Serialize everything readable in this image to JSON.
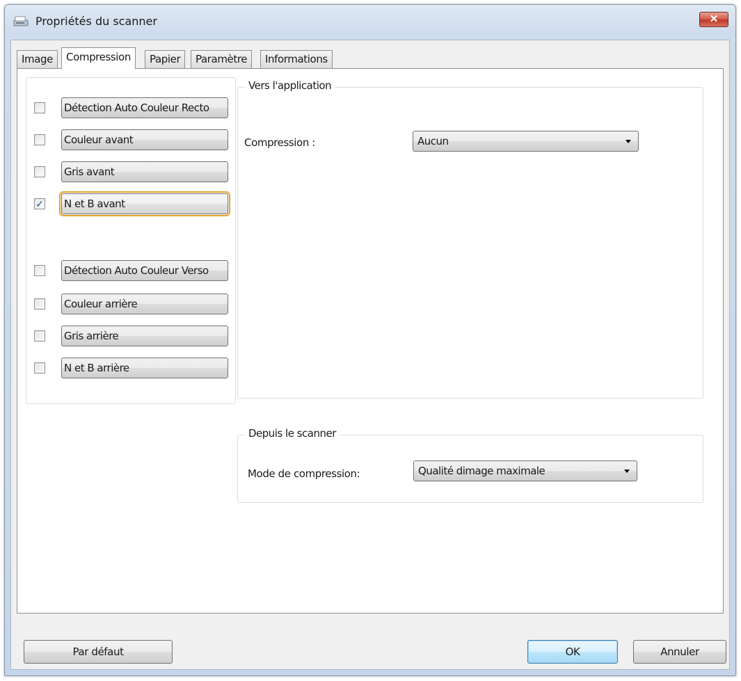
{
  "window": {
    "title": "Propriétés du scanner",
    "close_glyph": "✕"
  },
  "tabs": [
    {
      "label": "Image",
      "active": false
    },
    {
      "label": "Compression",
      "active": true
    },
    {
      "label": "Papier",
      "active": false
    },
    {
      "label": "Paramètre",
      "active": false
    },
    {
      "label": "Informations",
      "active": false
    }
  ],
  "image_types": [
    {
      "label": "Détection Auto Couleur Recto",
      "checked": false
    },
    {
      "label": "Couleur avant",
      "checked": false
    },
    {
      "label": "Gris avant",
      "checked": false
    },
    {
      "label": "N et B avant",
      "checked": true,
      "focused": true
    },
    {
      "label": "Détection Auto Couleur Verso",
      "checked": false
    },
    {
      "label": "Couleur arrière",
      "checked": false
    },
    {
      "label": "Gris arrière",
      "checked": false
    },
    {
      "label": "N et B arrière",
      "checked": false
    }
  ],
  "check_glyph": "✓",
  "to_application": {
    "group_label": "Vers l'application",
    "compression_label": "Compression :",
    "compression_value": "Aucun"
  },
  "from_scanner": {
    "group_label": "Depuis le scanner",
    "mode_label": "Mode de compression:",
    "mode_value": "Qualité dimage maximale"
  },
  "footer": {
    "default_label": "Par défaut",
    "ok_label": "OK",
    "cancel_label": "Annuler"
  },
  "colors": {
    "focus_outline": "#e5a22c",
    "close_button": "#c0392b",
    "title_gradient": "#cfdced"
  },
  "icons": {
    "app": "scanner-icon",
    "close": "close-icon",
    "dropdown": "chevron-down-icon",
    "check": "checkmark-icon"
  }
}
